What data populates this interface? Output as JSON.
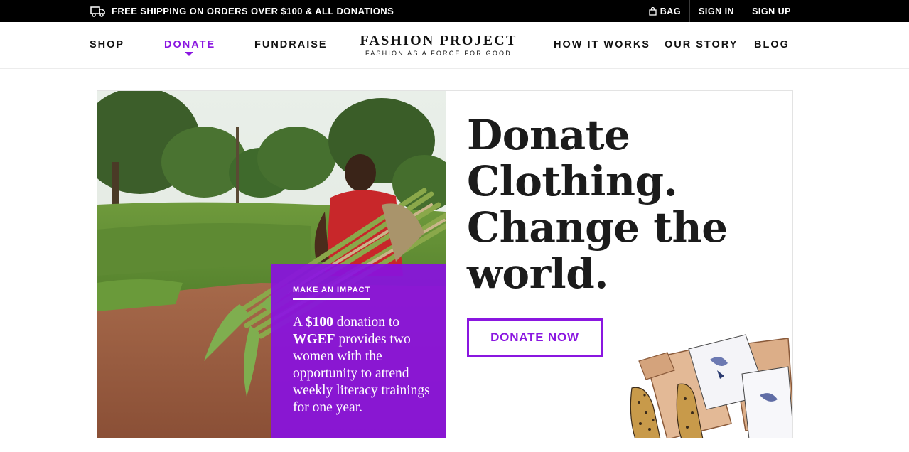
{
  "topbar": {
    "shipping_icon": "truck-icon",
    "shipping_text": "FREE SHIPPING ON ORDERS OVER $100 & ALL DONATIONS",
    "bag_icon": "bag-icon",
    "bag_label": "BAG",
    "signin_label": "SIGN IN",
    "signup_label": "SIGN UP"
  },
  "nav": {
    "shop": "SHOP",
    "donate": "DONATE",
    "fundraise": "FUNDRAISE",
    "how_it_works": "HOW IT WORKS",
    "our_story": "OUR STORY",
    "blog": "BLOG",
    "active_item": "DONATE",
    "accent_color": "#8a16e0"
  },
  "logo": {
    "title": "FASHION PROJECT",
    "tagline": "FASHION AS A FORCE FOR GOOD"
  },
  "hero": {
    "headline": [
      "Donate",
      "Clothing.",
      "Change the",
      "world."
    ],
    "button_label": "DONATE NOW",
    "impact_tag": "MAKE AN IMPACT",
    "impact_parts": [
      "A ",
      "$100",
      " donation to ",
      "WGEF",
      " provides two women with the opportunity to attend weekly literacy trainings for one year."
    ],
    "impact_color": "#8912de"
  }
}
